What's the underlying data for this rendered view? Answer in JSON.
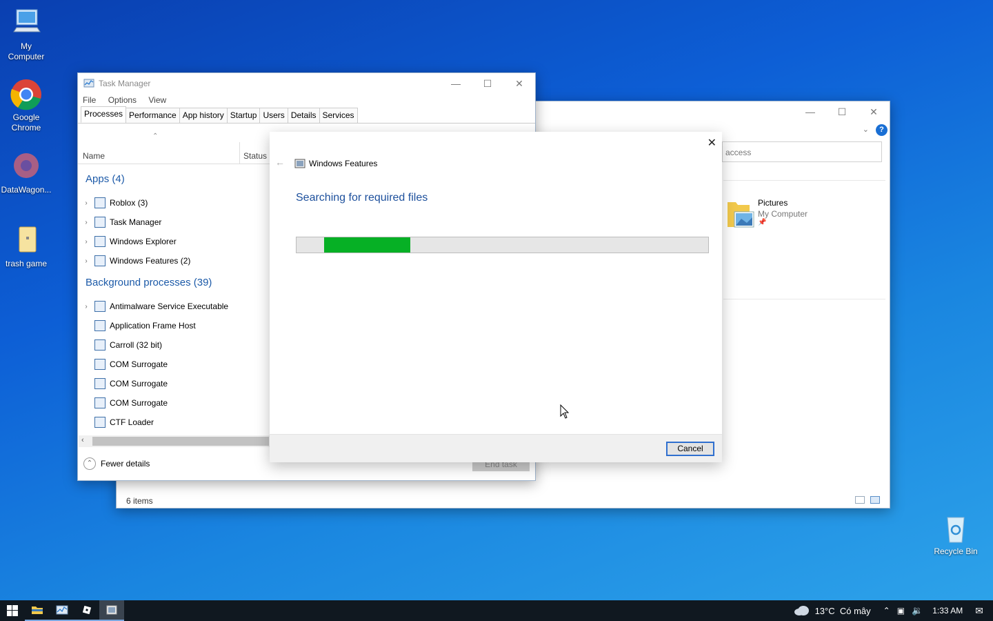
{
  "desktop": {
    "icons": [
      {
        "label": "My\nComputer",
        "icon": "computer-icon"
      },
      {
        "label": "Google\nChrome",
        "icon": "chrome-icon"
      },
      {
        "label": "DataWagon...",
        "icon": "datawagon-icon"
      },
      {
        "label": "trash game",
        "icon": "file-icon"
      },
      {
        "label": "Recycle Bin",
        "icon": "recycle-bin-icon"
      }
    ]
  },
  "task_manager": {
    "title": "Task Manager",
    "menu": [
      "File",
      "Options",
      "View"
    ],
    "tabs": [
      "Processes",
      "Performance",
      "App history",
      "Startup",
      "Users",
      "Details",
      "Services"
    ],
    "columns": {
      "name": "Name",
      "status": "Status"
    },
    "apps_header": "Apps (4)",
    "apps": [
      "Roblox (3)",
      "Task Manager",
      "Windows Explorer",
      "Windows Features (2)"
    ],
    "bg_header": "Background processes (39)",
    "background": [
      "Antimalware Service Executable",
      "Application Frame Host",
      "Carroll (32 bit)",
      "COM Surrogate",
      "COM Surrogate",
      "COM Surrogate",
      "CTF Loader"
    ],
    "fewer_details": "Fewer details",
    "end_task": "End task"
  },
  "explorer": {
    "search_text": "access",
    "item_name": "Pictures",
    "item_location": "My Computer",
    "status": "6 items"
  },
  "features_dialog": {
    "title": "Windows Features",
    "message": "Searching for required files",
    "progress": 0.21,
    "cancel": "Cancel",
    "accent": "#06b025"
  },
  "taskbar": {
    "weather": "13°C  Có mây",
    "time": "1:33 AM"
  }
}
